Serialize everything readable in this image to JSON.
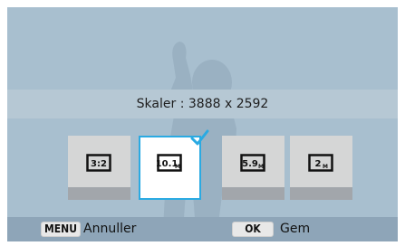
{
  "banner": {
    "text": "Skaler : 3888 x 2592"
  },
  "options": [
    {
      "icon": "aspect-3-2-icon",
      "label": "3:2",
      "selected": false
    },
    {
      "icon": "resolution-10m-icon",
      "label": "10.1M",
      "selected": true
    },
    {
      "icon": "resolution-5-9m-icon",
      "label": "5.9M",
      "selected": false
    },
    {
      "icon": "resolution-2m-icon",
      "label": "2M",
      "selected": false
    }
  ],
  "footer": {
    "menu_key": "MENU",
    "menu_label": "Annuller",
    "ok_key": "OK",
    "ok_label": "Gem"
  },
  "colors": {
    "selection": "#2aaae2",
    "tile": "#d5d6d6",
    "footer": "#8ea5b8"
  }
}
